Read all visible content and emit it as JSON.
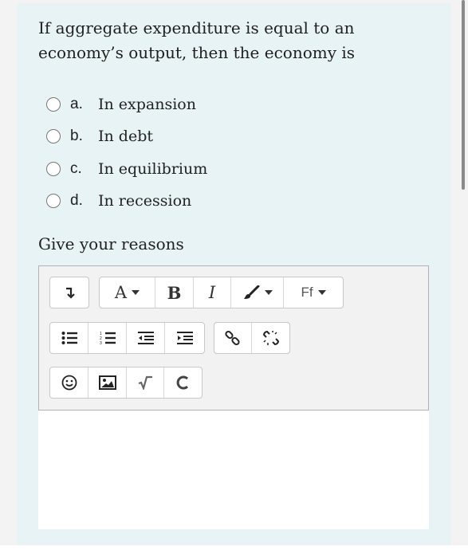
{
  "question": {
    "text": "If aggregate expenditure is equal to an economy’s output, then the economy is"
  },
  "options": [
    {
      "letter": "a.",
      "text": "In expansion"
    },
    {
      "letter": "b.",
      "text": "In debt"
    },
    {
      "letter": "c.",
      "text": "In equilibrium"
    },
    {
      "letter": "d.",
      "text": "In recession"
    }
  ],
  "reason_label": "Give your reasons",
  "toolbar": {
    "font_size_label": "A",
    "bold_label": "B",
    "italic_label": "I",
    "font_family_label": "Ff"
  }
}
